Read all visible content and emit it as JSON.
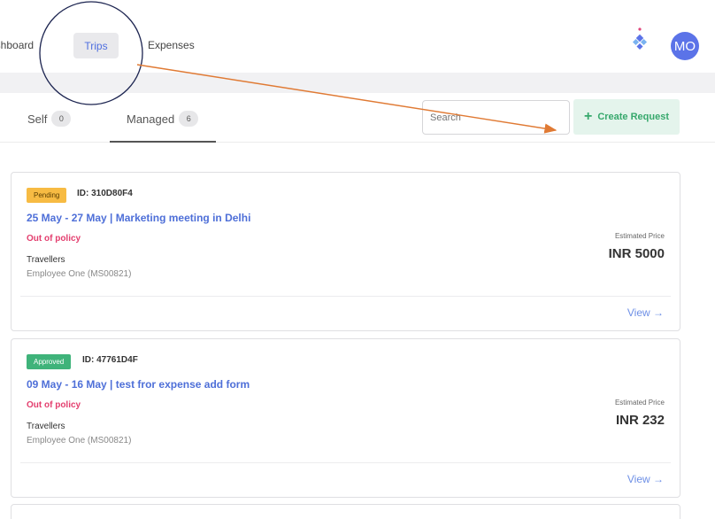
{
  "nav": {
    "dashboard": "ashboard",
    "trips": "Trips",
    "expenses": "Expenses",
    "avatar": "MO",
    "apps_icon": "apps-icon"
  },
  "tabs": {
    "self": {
      "label": "Self",
      "count": "0"
    },
    "managed": {
      "label": "Managed",
      "count": "6"
    }
  },
  "search": {
    "placeholder": "Search"
  },
  "create_button": {
    "label": "Create Request",
    "icon": "plus-icon"
  },
  "trips": [
    {
      "status": "Pending",
      "id": "ID: 310D80F4",
      "title": "25 May - 27 May | Marketing meeting in Delhi",
      "policy": "Out of policy",
      "travellers_label": "Travellers",
      "traveller": "Employee One (MS00821)",
      "price_label": "Estimated Price",
      "price": "INR 5000",
      "view": "View →"
    },
    {
      "status": "Approved",
      "id": "ID: 47761D4F",
      "title": "09 May - 16 May | test fror expense add form",
      "policy": "Out of policy",
      "travellers_label": "Travellers",
      "traveller": "Employee One (MS00821)",
      "price_label": "Estimated Price",
      "price": "INR 232",
      "view": "View →"
    }
  ],
  "colors": {
    "accent": "#4e6fd8",
    "pending": "#f7bb43",
    "approved": "#3fb37a",
    "policy": "#e33e6e",
    "create": "#36a86c",
    "annotation": "#e07a34"
  }
}
